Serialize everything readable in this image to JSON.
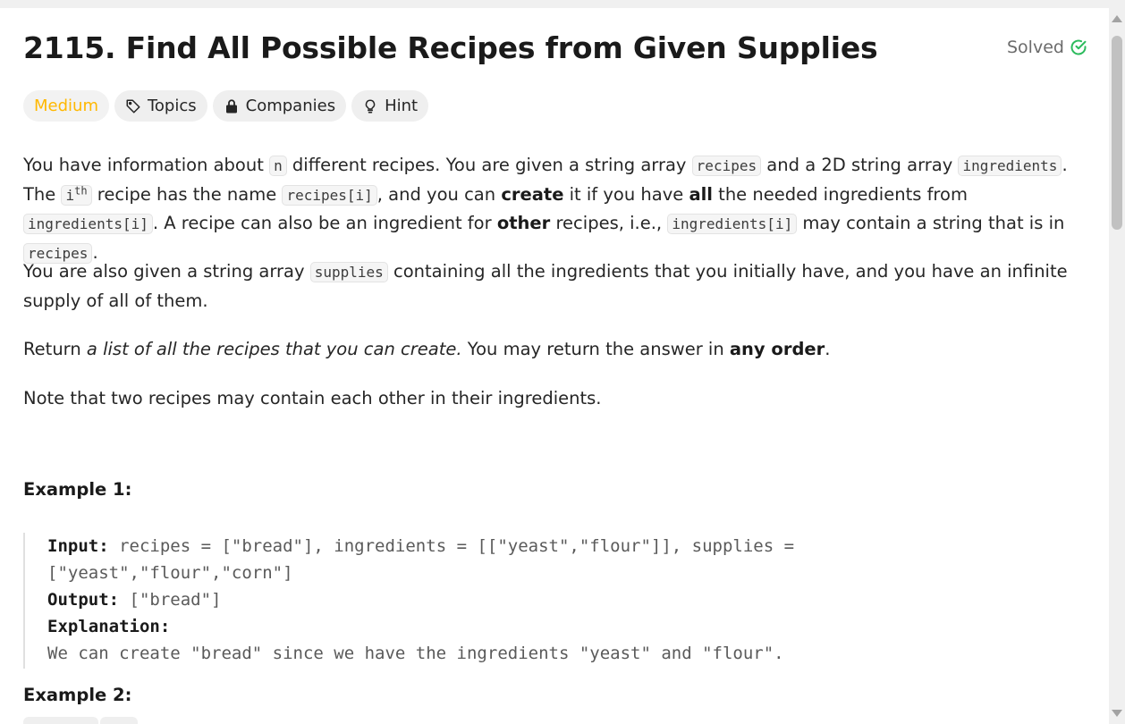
{
  "problem": {
    "title": "2115. Find All Possible Recipes from Given Supplies",
    "status": "Solved"
  },
  "tags": {
    "difficulty": "Medium",
    "topics": "Topics",
    "companies": "Companies",
    "hint": "Hint"
  },
  "description": {
    "p1": {
      "t1": "You have information about ",
      "c1": "n",
      "t2": " different recipes. You are given a string array ",
      "c2": "recipes",
      "t3": " and a 2D string array ",
      "c3": "ingredients",
      "t4": ". The ",
      "i": "i",
      "th": "th",
      "t5": " recipe has the name ",
      "c4": "recipes[i]",
      "t6": ", and you can ",
      "b1": "create",
      "t7": " it if you have ",
      "b2": "all",
      "t8": " the needed ingredients from ",
      "c5": "ingredients[i]",
      "t9": ". A recipe can also be an ingredient for ",
      "b3": "other",
      "t10": " recipes, i.e., ",
      "c6": "ingredients[i]",
      "t11": " may contain a string that is in ",
      "c7": "recipes",
      "t12": "."
    },
    "p2": {
      "t1": "You are also given a string array ",
      "c1": "supplies",
      "t2": " containing all the ingredients that you initially have, and you have an infinite supply of all of them."
    },
    "p3": {
      "t1": "Return ",
      "em": "a list of all the recipes that you can create.",
      "t2": " You may return the answer in ",
      "b": "any order",
      "t3": "."
    },
    "p4": "Note that two recipes may contain each other in their ingredients."
  },
  "examples": [
    {
      "heading": "Example 1:",
      "input_label": "Input:",
      "input_line1": " recipes = [\"bread\"], ingredients = [[\"yeast\",\"flour\"]], supplies =",
      "input_line2": "[\"yeast\",\"flour\",\"corn\"]",
      "output_label": "Output:",
      "output_value": " [\"bread\"]",
      "explanation_label": "Explanation:",
      "explanation_text": "We can create \"bread\" since we have the ingredients \"yeast\" and \"flour\"."
    },
    {
      "heading": "Example 2:"
    }
  ],
  "colors": {
    "medium": "#ffb800",
    "solved_check": "#2cbb5d"
  }
}
